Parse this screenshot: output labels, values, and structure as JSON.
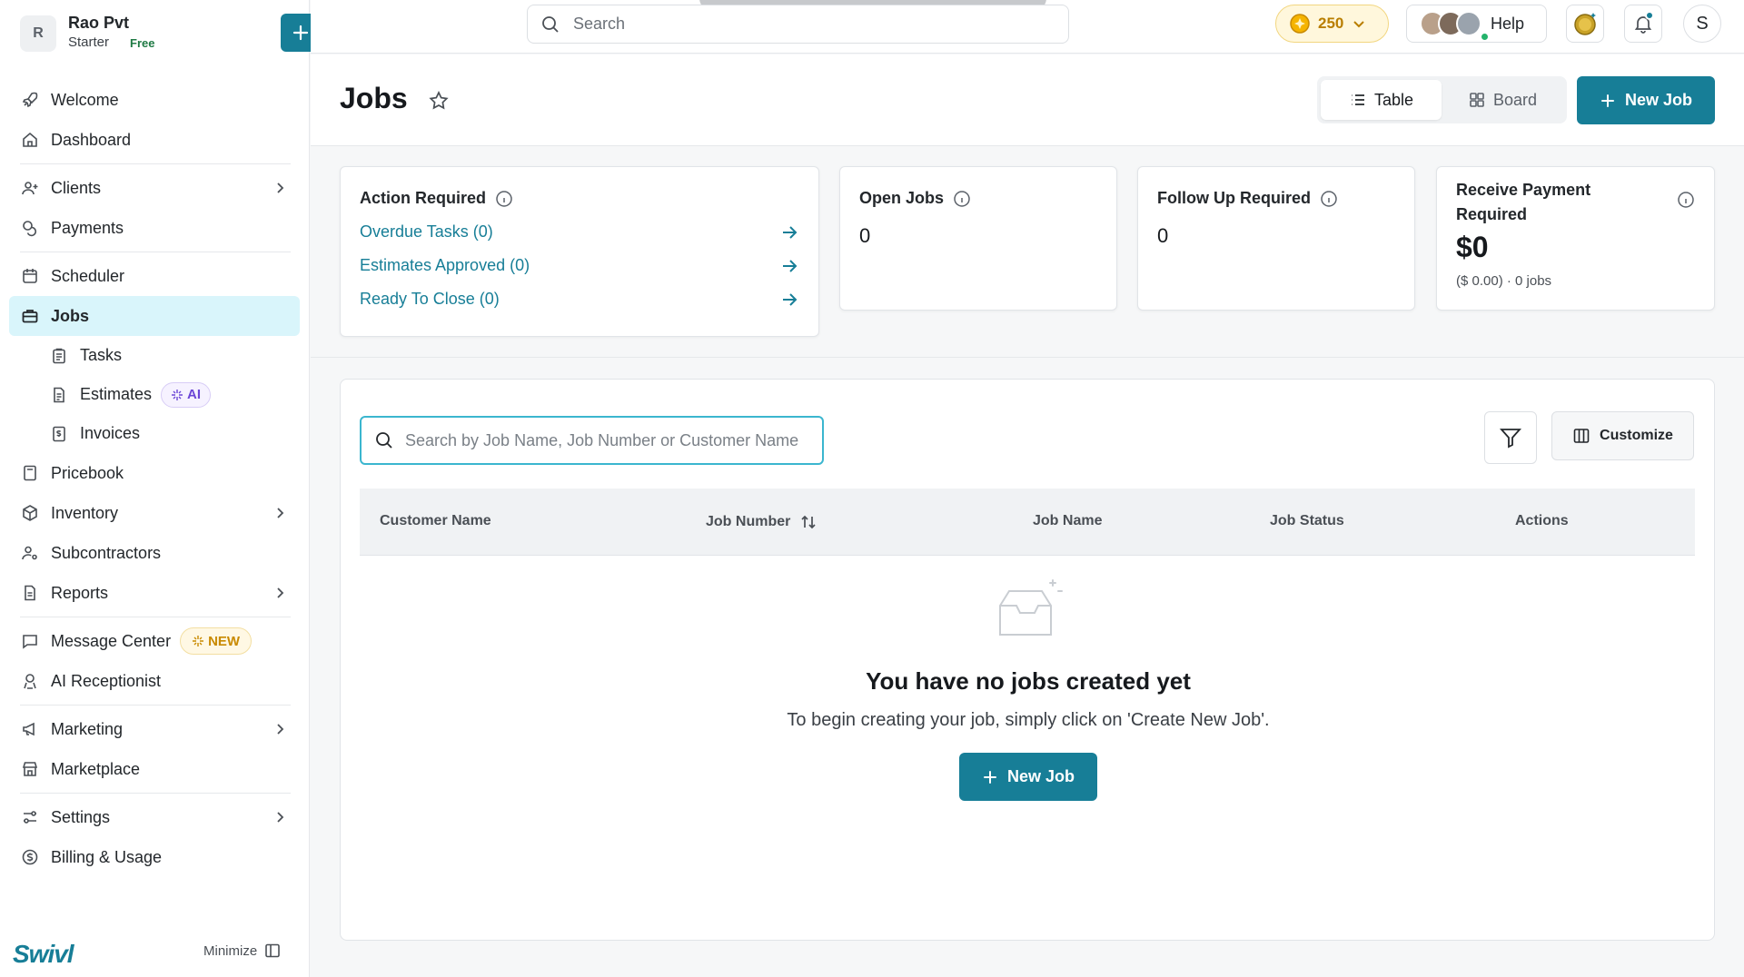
{
  "org": {
    "initial": "R",
    "name": "Rao Pvt",
    "plan": "Starter",
    "plan_badge": "Free"
  },
  "sidebar": {
    "items": [
      {
        "label": "Welcome"
      },
      {
        "label": "Dashboard"
      },
      {
        "label": "Clients"
      },
      {
        "label": "Payments"
      },
      {
        "label": "Scheduler"
      },
      {
        "label": "Jobs"
      },
      {
        "label": "Tasks"
      },
      {
        "label": "Estimates",
        "badge": "AI"
      },
      {
        "label": "Invoices"
      },
      {
        "label": "Pricebook"
      },
      {
        "label": "Inventory"
      },
      {
        "label": "Subcontractors"
      },
      {
        "label": "Reports"
      },
      {
        "label": "Message Center",
        "badge": "NEW"
      },
      {
        "label": "AI Receptionist"
      },
      {
        "label": "Marketing"
      },
      {
        "label": "Marketplace"
      },
      {
        "label": "Settings"
      },
      {
        "label": "Billing & Usage"
      }
    ],
    "brand": "Swivl",
    "minimize_label": "Minimize"
  },
  "topbar": {
    "search_placeholder": "Search",
    "coins": "250",
    "help_label": "Help",
    "user_initial": "S"
  },
  "header": {
    "title": "Jobs",
    "view_table": "Table",
    "view_board": "Board",
    "new_job": "New Job"
  },
  "cards": {
    "action_required": {
      "title": "Action Required",
      "links": [
        "Overdue Tasks (0)",
        "Estimates Approved (0)",
        "Ready To Close (0)"
      ]
    },
    "open_jobs": {
      "title": "Open Jobs",
      "value": "0"
    },
    "follow_up": {
      "title": "Follow Up Required",
      "value": "0"
    },
    "receive_payment": {
      "title": "Receive Payment Required",
      "value": "$0",
      "sub": "($ 0.00) · 0 jobs"
    }
  },
  "jobs": {
    "search_placeholder": "Search by Job Name, Job Number or Customer Name",
    "customize_label": "Customize",
    "columns": [
      "Customer Name",
      "Job Number",
      "Job Name",
      "Job Status",
      "Actions"
    ],
    "empty_title": "You have no jobs created yet",
    "empty_sub": "To begin creating your job, simply click on 'Create New Job'.",
    "new_job": "New Job"
  },
  "colors": {
    "accent": "#177e97",
    "active_nav": "#d9f5fb",
    "coin": "#b97e00"
  }
}
